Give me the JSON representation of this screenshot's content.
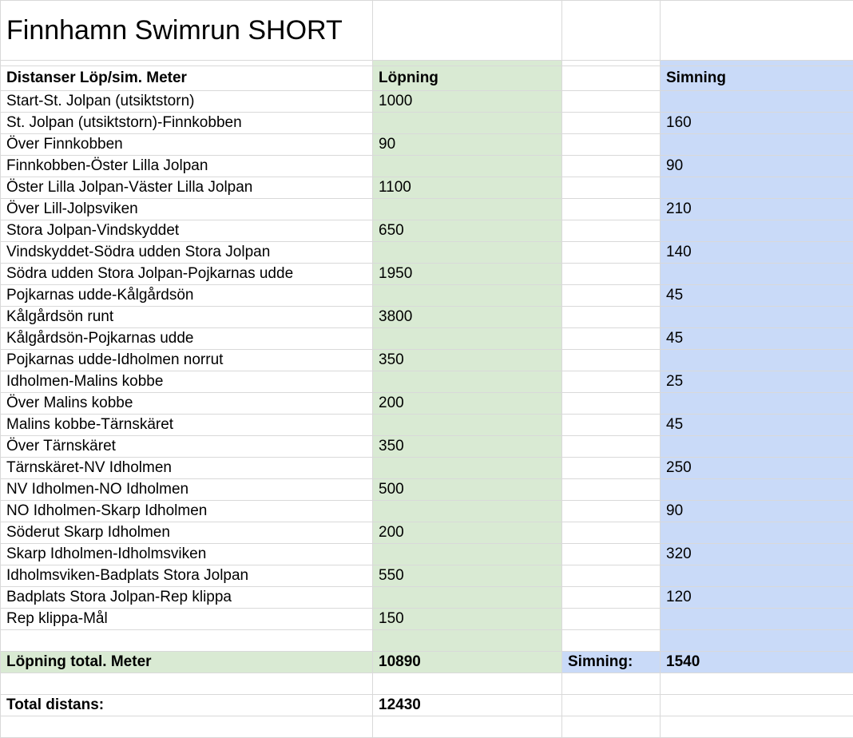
{
  "sheet": {
    "title": "Finnhamn Swimrun  SHORT",
    "headers": {
      "name": "Distanser Löp/sim.  Meter",
      "run": "Löpning",
      "swim": "Simning"
    },
    "rows": [
      {
        "name": "Start-St. Jolpan (utsiktstorn)",
        "run": "1000",
        "swim": ""
      },
      {
        "name": "St. Jolpan (utsiktstorn)-Finnkobben",
        "run": "",
        "swim": "160"
      },
      {
        "name": "Över Finnkobben",
        "run": "90",
        "swim": ""
      },
      {
        "name": "Finnkobben-Öster Lilla Jolpan",
        "run": "",
        "swim": "90"
      },
      {
        "name": "Öster Lilla Jolpan-Väster Lilla Jolpan",
        "run": "1100",
        "swim": ""
      },
      {
        "name": "Över Lill-Jolpsviken",
        "run": "",
        "swim": "210"
      },
      {
        "name": "Stora Jolpan-Vindskyddet",
        "run": "650",
        "swim": ""
      },
      {
        "name": "Vindskyddet-Södra udden Stora Jolpan",
        "run": "",
        "swim": "140"
      },
      {
        "name": "Södra udden Stora Jolpan-Pojkarnas udde",
        "run": "1950",
        "swim": ""
      },
      {
        "name": "Pojkarnas udde-Kålgårdsön",
        "run": "",
        "swim": "45"
      },
      {
        "name": "Kålgårdsön runt",
        "run": "3800",
        "swim": ""
      },
      {
        "name": "Kålgårdsön-Pojkarnas udde",
        "run": "",
        "swim": "45"
      },
      {
        "name": "Pojkarnas udde-Idholmen norrut",
        "run": "350",
        "swim": ""
      },
      {
        "name": "Idholmen-Malins kobbe",
        "run": "",
        "swim": "25"
      },
      {
        "name": "Över Malins kobbe",
        "run": "200",
        "swim": ""
      },
      {
        "name": "Malins kobbe-Tärnskäret",
        "run": "",
        "swim": "45"
      },
      {
        "name": "Över Tärnskäret",
        "run": "350",
        "swim": ""
      },
      {
        "name": "Tärnskäret-NV Idholmen",
        "run": "",
        "swim": "250"
      },
      {
        "name": "NV Idholmen-NO Idholmen",
        "run": "500",
        "swim": ""
      },
      {
        "name": "NO Idholmen-Skarp Idholmen",
        "run": "",
        "swim": "90"
      },
      {
        "name": "Söderut Skarp Idholmen",
        "run": "200",
        "swim": ""
      },
      {
        "name": "Skarp Idholmen-Idholmsviken",
        "run": "",
        "swim": "320"
      },
      {
        "name": "Idholmsviken-Badplats Stora Jolpan",
        "run": "550",
        "swim": ""
      },
      {
        "name": "Badplats Stora Jolpan-Rep klippa",
        "run": "",
        "swim": "120"
      },
      {
        "name": "Rep klippa-Mål",
        "run": "150",
        "swim": ""
      },
      {
        "name": "",
        "run": "",
        "swim": ""
      }
    ],
    "totals": {
      "run_label": "Löpning total. Meter",
      "run_value": "10890",
      "swim_label": "Simning:",
      "swim_value": "1540",
      "total_label": "Total distans:",
      "total_value": "12430"
    },
    "colors": {
      "run_fill": "#d9ead3",
      "swim_fill": "#c9daf8",
      "grid": "#d9d9d9"
    }
  }
}
